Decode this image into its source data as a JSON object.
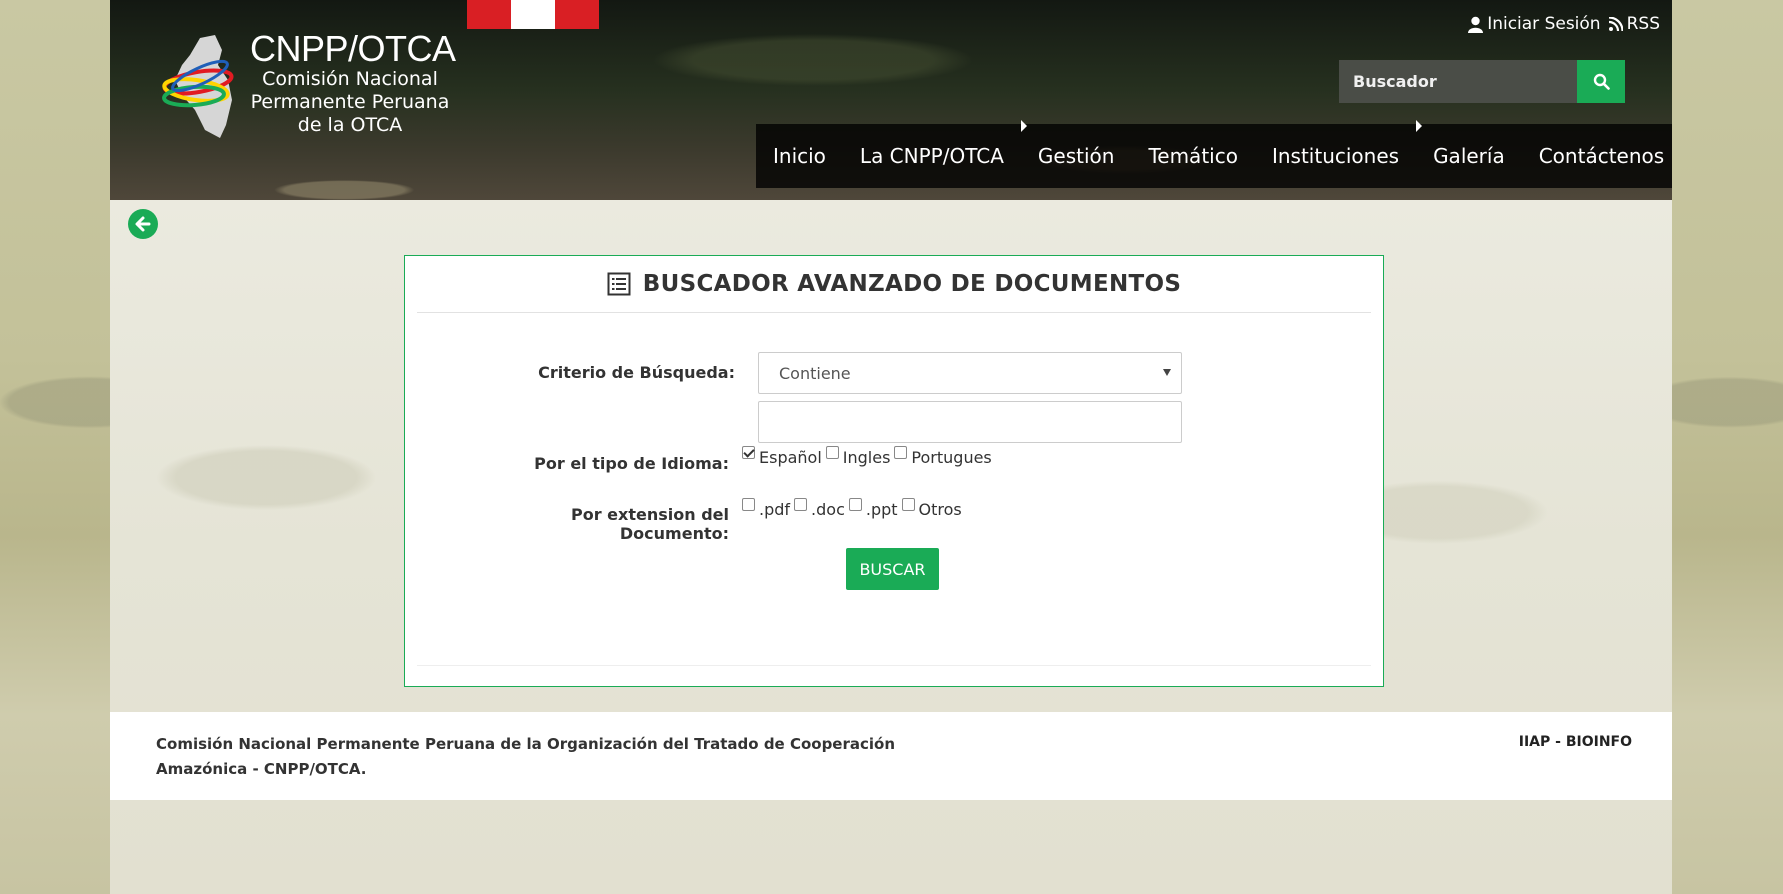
{
  "header": {
    "brand_title": "CNPP/OTCA",
    "brand_line1": "Comisión Nacional",
    "brand_line2": "Permanente Peruana",
    "brand_line3": "de la OTCA",
    "login_label": "Iniciar Sesión",
    "rss_label": "RSS",
    "search_placeholder": "Buscador"
  },
  "nav": {
    "items": [
      {
        "label": "Inicio"
      },
      {
        "label": "La CNPP/OTCA"
      },
      {
        "label": "Gestión"
      },
      {
        "label": "Temático"
      },
      {
        "label": "Instituciones"
      },
      {
        "label": "Galería"
      },
      {
        "label": "Contáctenos"
      }
    ]
  },
  "panel": {
    "title": "BUSCADOR AVANZADO DE DOCUMENTOS",
    "criterio_label": "Criterio de Búsqueda:",
    "criterio_value": "Contiene",
    "search_text_value": "",
    "idioma_label": "Por el tipo de Idioma:",
    "idiomas": [
      {
        "label": "Español",
        "checked": true
      },
      {
        "label": "Ingles",
        "checked": false
      },
      {
        "label": "Portugues",
        "checked": false
      }
    ],
    "extension_label": "Por extension del Documento:",
    "extensiones": [
      {
        "label": ".pdf",
        "checked": false
      },
      {
        "label": ".doc",
        "checked": false
      },
      {
        "label": ".ppt",
        "checked": false
      },
      {
        "label": "Otros",
        "checked": false
      }
    ],
    "buscar_label": "BUSCAR"
  },
  "footer": {
    "left_text": "Comisión Nacional Permanente Peruana de la Organización del Tratado de Cooperación Amazónica - CNPP/OTCA.",
    "right_text": "IIAP - BIOINFO"
  },
  "colors": {
    "accent_green": "#1aab56",
    "flag_red": "#d91f24"
  }
}
